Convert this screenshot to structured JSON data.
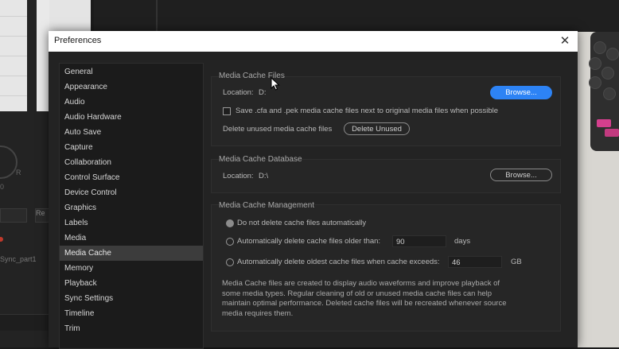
{
  "dialog": {
    "title": "Preferences"
  },
  "sidebar": {
    "items": [
      {
        "label": "General"
      },
      {
        "label": "Appearance"
      },
      {
        "label": "Audio"
      },
      {
        "label": "Audio Hardware"
      },
      {
        "label": "Auto Save"
      },
      {
        "label": "Capture"
      },
      {
        "label": "Collaboration"
      },
      {
        "label": "Control Surface"
      },
      {
        "label": "Device Control"
      },
      {
        "label": "Graphics"
      },
      {
        "label": "Labels"
      },
      {
        "label": "Media"
      },
      {
        "label": "Media Cache"
      },
      {
        "label": "Memory"
      },
      {
        "label": "Playback"
      },
      {
        "label": "Sync Settings"
      },
      {
        "label": "Timeline"
      },
      {
        "label": "Trim"
      }
    ],
    "selected": "Media Cache"
  },
  "cache_files": {
    "title": "Media Cache Files",
    "location_label": "Location:",
    "location_value": "D:",
    "browse_label": "Browse...",
    "save_checkbox_label": "Save .cfa and .pek media cache files next to original media files when possible",
    "delete_label": "Delete unused media cache files",
    "delete_button": "Delete Unused"
  },
  "cache_database": {
    "title": "Media Cache Database",
    "location_label": "Location:",
    "location_value": "D:\\",
    "browse_label": "Browse..."
  },
  "cache_management": {
    "title": "Media Cache Management",
    "option_none": "Do not delete cache files automatically",
    "option_older": "Automatically delete cache files older than:",
    "older_value": "90",
    "older_unit": "days",
    "option_exceeds": "Automatically delete oldest cache files when cache exceeds:",
    "exceeds_value": "46",
    "exceeds_unit": "GB",
    "description": "Media Cache files are created to display audio waveforms and improve playback of some media types.  Regular cleaning of old or unused media cache files can help maintain optimal performance. Deleted cache files will be recreated whenever source media requires them."
  },
  "background": {
    "knob_label": "R",
    "knob_label2": "0",
    "ctrl_label": "Re",
    "sequence_name": "Sync_part1"
  },
  "colors": {
    "accent": "#2d83f5",
    "pink": "#d43f8d"
  }
}
